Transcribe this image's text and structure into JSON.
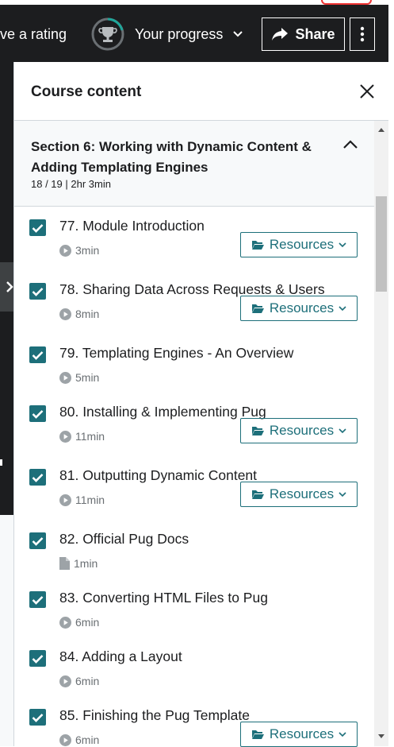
{
  "topbar": {
    "rating_text": "ve a rating",
    "progress_label": "Your progress",
    "share_label": "Share"
  },
  "panel": {
    "title": "Course content",
    "section": {
      "title": "Section 6: Working with Dynamic Content & Adding Templating Engines",
      "meta": "18 / 19 | 2hr 3min"
    },
    "items": [
      {
        "title": "77. Module Introduction",
        "duration": "3min",
        "type": "video",
        "resources": "Resources"
      },
      {
        "title": "78. Sharing Data Across Requests & Users",
        "duration": "8min",
        "type": "video",
        "resources": "Resources"
      },
      {
        "title": "79. Templating Engines - An Overview",
        "duration": "5min",
        "type": "video"
      },
      {
        "title": "80. Installing & Implementing Pug",
        "duration": "11min",
        "type": "video",
        "resources": "Resources"
      },
      {
        "title": "81. Outputting Dynamic Content",
        "duration": "11min",
        "type": "video",
        "resources": "Resources"
      },
      {
        "title": "82. Official Pug Docs",
        "duration": "1min",
        "type": "article"
      },
      {
        "title": "83. Converting HTML Files to Pug",
        "duration": "6min",
        "type": "video"
      },
      {
        "title": "84. Adding a Layout",
        "duration": "6min",
        "type": "video"
      },
      {
        "title": "85. Finishing the Pug Template",
        "duration": "6min",
        "type": "video",
        "resources": "Resources"
      }
    ]
  },
  "colors": {
    "topbar_bg": "#1c1d1f",
    "accent_teal": "#1d6f7a",
    "progress_ring": "#1ea69a"
  }
}
